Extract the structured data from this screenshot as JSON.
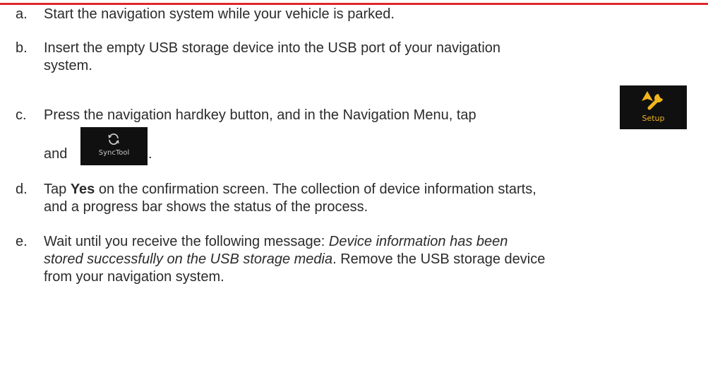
{
  "steps": [
    {
      "letter": "a.",
      "lines": [
        "Start the navigation system while your vehicle is parked."
      ]
    },
    {
      "letter": "b.",
      "lines": [
        "Insert the empty USB storage device into the USB port of your navigation",
        "system."
      ]
    },
    {
      "letter": "c.",
      "text": "Press the navigation hardkey button, and in the Navigation Menu, tap"
    },
    {
      "and": "and",
      "period": "."
    },
    {
      "letter": "d.",
      "pre": "Tap ",
      "bold": "Yes",
      "post": " on the confirmation screen. The collection of device information starts,",
      "line2": "and a progress bar shows the status of the process."
    },
    {
      "letter": "e.",
      "pre": "Wait until you receive the following message: ",
      "italic1": "Device information has been",
      "italic2": "stored successfully on the USB storage media",
      "post2": ". Remove the USB storage device",
      "line3": "from your navigation system."
    }
  ],
  "tiles": {
    "setup": {
      "label": "Setup",
      "icon": "setup-wrench-icon",
      "color": "#f2b51c"
    },
    "synctool": {
      "label": "SyncTool",
      "icon": "sync-icon",
      "color": "#c8c8c8"
    }
  },
  "colors": {
    "rule": "#e0262a",
    "text": "#2b2b2b",
    "tile_bg": "#101010"
  }
}
